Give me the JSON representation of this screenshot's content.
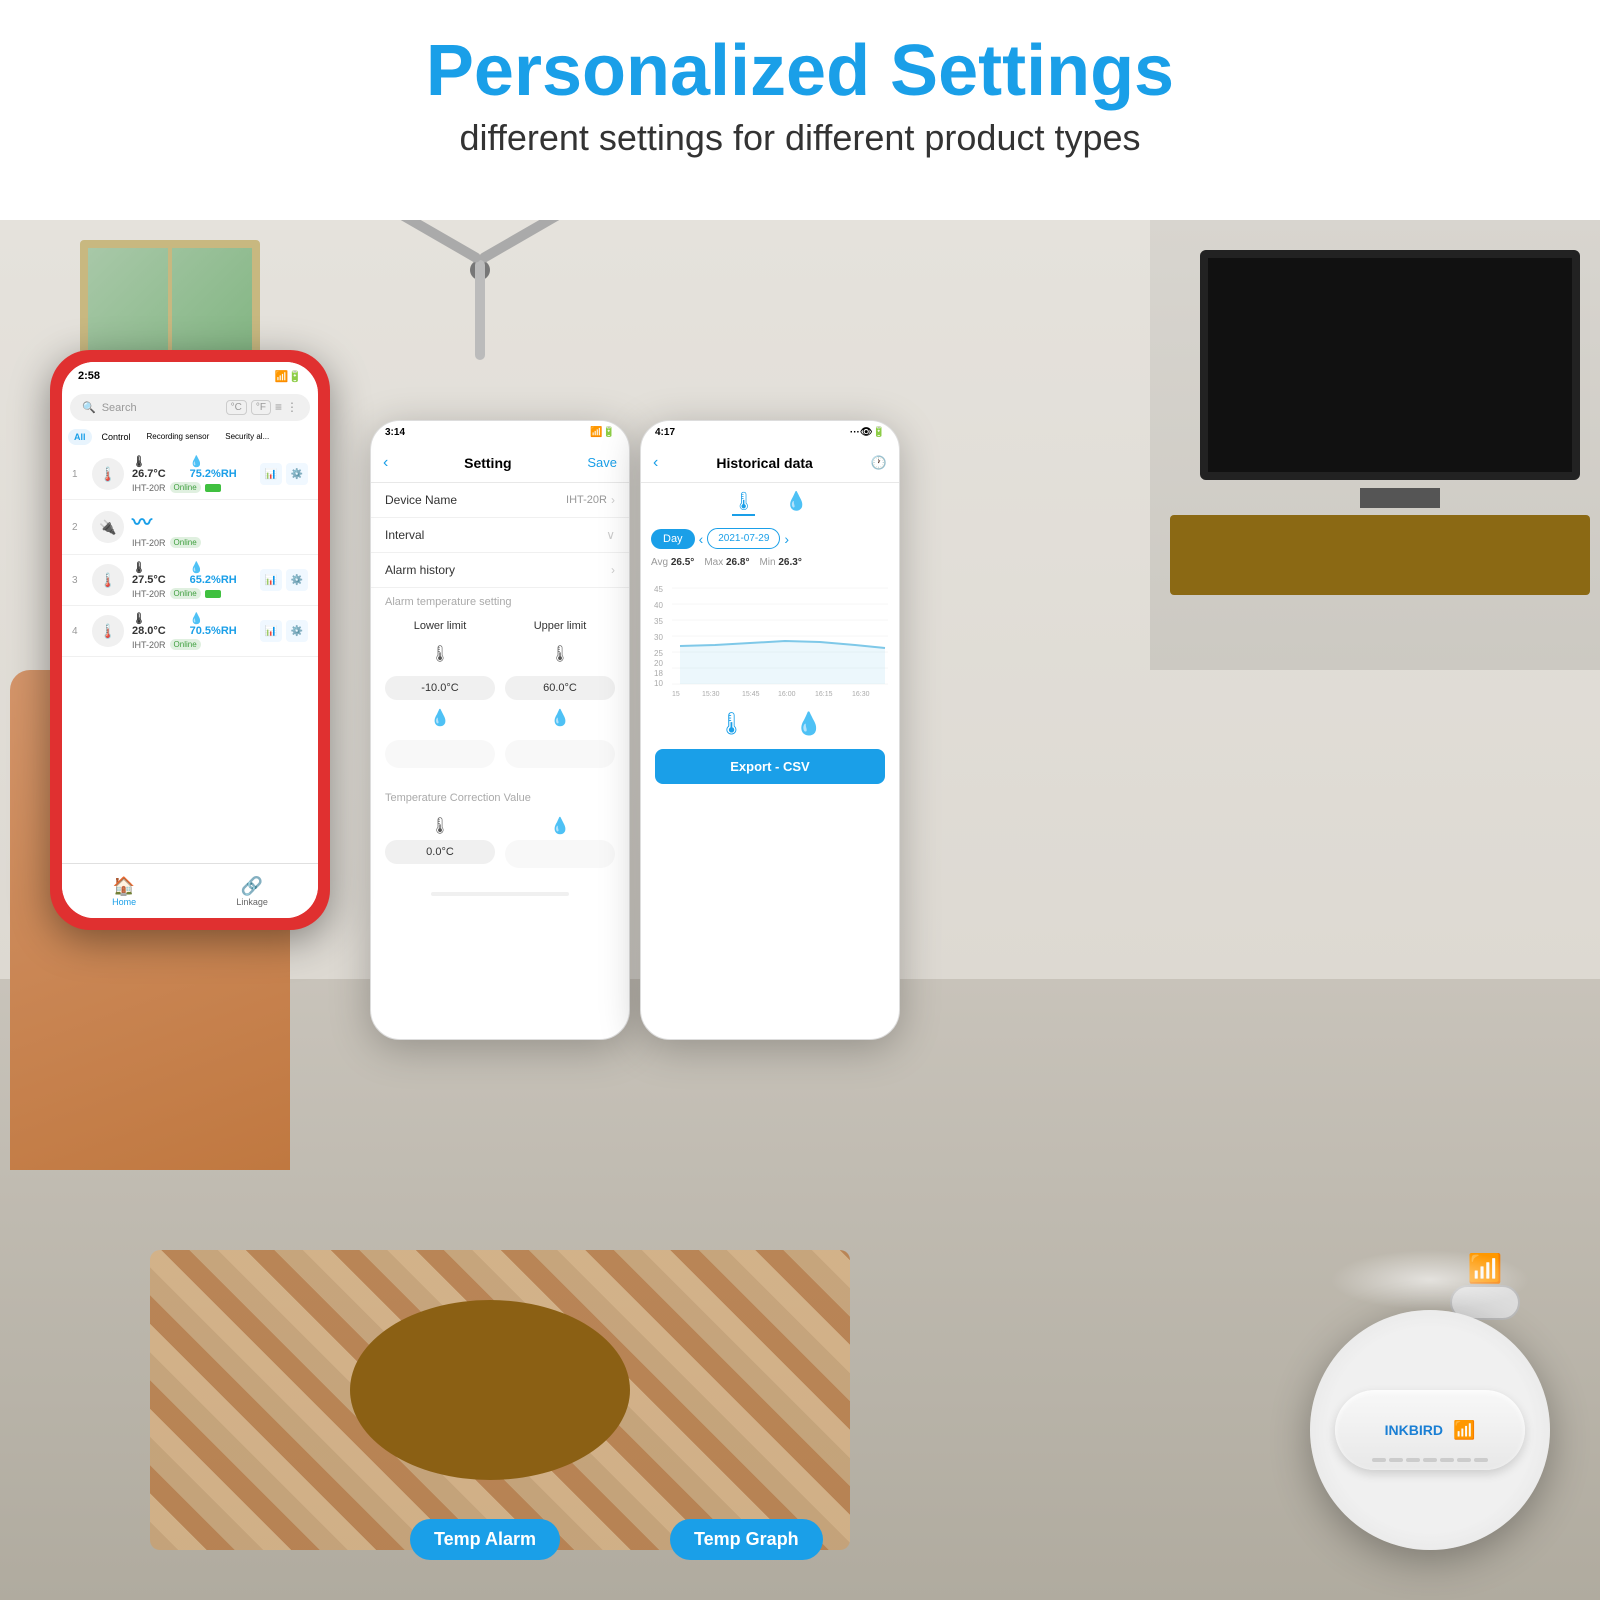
{
  "header": {
    "title": "Personalized Settings",
    "subtitle": "different settings for different product types"
  },
  "phone_left": {
    "status_time": "2:58",
    "search_placeholder": "Search",
    "tabs": [
      "All",
      "Control",
      "Recording sensor",
      "Security al..."
    ],
    "devices": [
      {
        "num": "1",
        "temp": "26.7°C",
        "humid": "75.2%RH",
        "name": "IHT-20R",
        "status": "Online"
      },
      {
        "num": "2",
        "name": "IHT-20R",
        "status": "Online"
      },
      {
        "num": "3",
        "temp": "27.5°C",
        "humid": "65.2%RH",
        "name": "IHT-20R",
        "status": "Online"
      },
      {
        "num": "4",
        "temp": "28.0°C",
        "humid": "70.5%RH",
        "name": "IHT-20R",
        "status": "Online"
      }
    ],
    "nav": [
      "Home",
      "Linkage"
    ]
  },
  "phone_mid": {
    "status_time": "3:14",
    "title": "Setting",
    "save_label": "Save",
    "device_name_label": "Device Name",
    "device_name_value": "IHT-20R",
    "interval_label": "Interval",
    "alarm_history_label": "Alarm history",
    "alarm_temp_setting": "Alarm temperature setting",
    "lower_limit_label": "Lower limit",
    "upper_limit_label": "Upper limit",
    "lower_value": "-10.0°C",
    "upper_value": "60.0°C",
    "temp_correction_label": "Temperature Correction Value",
    "correction_value": "0.0°C"
  },
  "phone_right": {
    "status_time": "4:17",
    "title": "Historical data",
    "day_label": "Day",
    "date": "2021-07-29",
    "avg_label": "Avg",
    "avg_value": "26.5°",
    "max_label": "Max",
    "max_value": "26.8°",
    "min_label": "Min",
    "min_value": "26.3°",
    "export_label": "Export - CSV",
    "chart_times": [
      "15",
      "15:30",
      "15:45",
      "16:00",
      "16:15",
      "16:30"
    ],
    "chart_data": [
      26.4,
      26.5,
      26.6,
      26.8,
      26.7,
      26.5,
      26.3
    ]
  },
  "labels": {
    "temp_alarm": "Temp Alarm",
    "temp_graph": "Temp Graph"
  },
  "inkbird": {
    "logo": "INKBIRD"
  }
}
